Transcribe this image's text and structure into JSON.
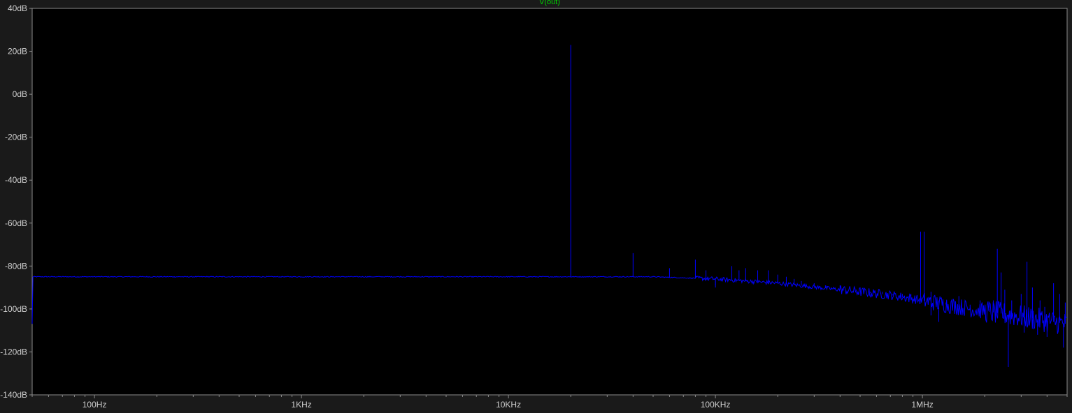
{
  "window": {
    "background": "#1a1a1a",
    "plot_background": "#000000",
    "frame_color": "#8c8c8c",
    "tick_label_color": "#cfcfcf"
  },
  "chart_data": {
    "type": "line",
    "title": "",
    "xlabel": "",
    "ylabel": "",
    "x_scale": "log",
    "xlim": [
      50,
      5000000
    ],
    "ylim": [
      -140,
      40
    ],
    "grid": false,
    "legend": "top-center",
    "y_ticks": [
      {
        "value": 40,
        "label": "40dB"
      },
      {
        "value": 20,
        "label": "20dB"
      },
      {
        "value": 0,
        "label": "0dB"
      },
      {
        "value": -20,
        "label": "-20dB"
      },
      {
        "value": -40,
        "label": "-40dB"
      },
      {
        "value": -60,
        "label": "-60dB"
      },
      {
        "value": -80,
        "label": "-80dB"
      },
      {
        "value": -100,
        "label": "-100dB"
      },
      {
        "value": -120,
        "label": "-120dB"
      },
      {
        "value": -140,
        "label": "-140dB"
      }
    ],
    "x_ticks": [
      {
        "value": 100,
        "label": "100Hz"
      },
      {
        "value": 1000,
        "label": "1KHz"
      },
      {
        "value": 10000,
        "label": "10KHz"
      },
      {
        "value": 100000,
        "label": "100KHz"
      },
      {
        "value": 1000000,
        "label": "1MHz"
      }
    ],
    "series": [
      {
        "name": "V(out)",
        "label_color": "#00d000",
        "color": "#0000ff",
        "noise_floor": [
          [
            50,
            -85
          ],
          [
            10000,
            -85
          ],
          [
            50000,
            -85
          ],
          [
            100000,
            -86
          ],
          [
            200000,
            -88
          ],
          [
            400000,
            -91
          ],
          [
            700000,
            -93.5
          ],
          [
            1000000,
            -96
          ],
          [
            1500000,
            -99
          ],
          [
            2000000,
            -101
          ],
          [
            3000000,
            -103.5
          ],
          [
            4000000,
            -105.5
          ],
          [
            5000000,
            -107
          ]
        ],
        "peaks": [
          [
            20000,
            23
          ],
          [
            40000,
            -74
          ],
          [
            60000,
            -81
          ],
          [
            80000,
            -77
          ],
          [
            90000,
            -82
          ],
          [
            100000,
            -89
          ],
          [
            120000,
            -80
          ],
          [
            130000,
            -82
          ],
          [
            140000,
            -81
          ],
          [
            160000,
            -82
          ],
          [
            180000,
            -82
          ],
          [
            200000,
            -84
          ],
          [
            220000,
            -85
          ],
          [
            240000,
            -86
          ],
          [
            260000,
            -87
          ],
          [
            300000,
            -88
          ],
          [
            340000,
            -89
          ],
          [
            400000,
            -89
          ],
          [
            480000,
            -91
          ],
          [
            560000,
            -92
          ],
          [
            640000,
            -92
          ],
          [
            720000,
            -93
          ],
          [
            800000,
            -93
          ],
          [
            880000,
            -93
          ],
          [
            980000,
            -64
          ],
          [
            1020000,
            -64
          ],
          [
            1100000,
            -92
          ],
          [
            1200000,
            -96
          ],
          [
            1300000,
            -97
          ],
          [
            1500000,
            -94
          ],
          [
            1700000,
            -98
          ],
          [
            1900000,
            -96
          ],
          [
            2100000,
            -100
          ],
          [
            2200000,
            -96
          ],
          [
            2300000,
            -72
          ],
          [
            2400000,
            -83
          ],
          [
            2500000,
            -91
          ],
          [
            2700000,
            -96
          ],
          [
            3000000,
            -93
          ],
          [
            3200000,
            -78
          ],
          [
            3400000,
            -90
          ],
          [
            3700000,
            -96
          ],
          [
            3900000,
            -99
          ],
          [
            4300000,
            -88
          ],
          [
            4600000,
            -93
          ],
          [
            4900000,
            -97
          ]
        ],
        "dips": [
          [
            100000,
            -90
          ],
          [
            1100000,
            -103
          ],
          [
            1200000,
            -106
          ],
          [
            2600000,
            -127
          ],
          [
            3100000,
            -111
          ],
          [
            3600000,
            -112
          ],
          [
            4000000,
            -113
          ],
          [
            4800000,
            -118
          ]
        ]
      }
    ]
  }
}
